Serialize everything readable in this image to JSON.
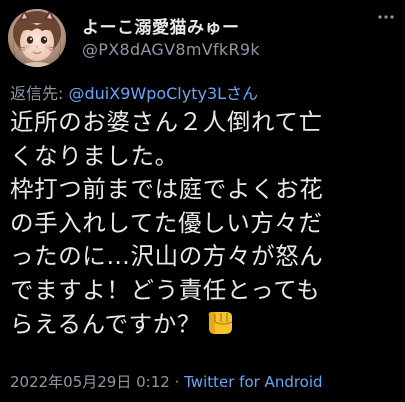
{
  "author": {
    "display_name": "よーこ溺愛猫みゅー",
    "handle": "@PX8dAGV8mVfkR9k"
  },
  "reply_to": {
    "prefix": "返信先: ",
    "handle": "@duiX9WpoClyty3Lさん"
  },
  "tweet": {
    "lines": [
      "近所のお婆さん２人倒れて亡",
      "くなりました。",
      "枠打つ前までは庭でよくお花",
      "の手入れしてた優しい方々だ",
      "ったのに…沢山の方々が怒ん",
      "でますよ！どう責任とっても",
      "らえるんですか？"
    ],
    "emoji": "oncoming-fist"
  },
  "meta": {
    "timestamp": "2022年05月29日 0:12",
    "separator": " · ",
    "source": "Twitter for Android"
  },
  "colors": {
    "background": "#000000",
    "text": "#e7e9ea",
    "secondary": "#8b98a5",
    "link": "#6aa6f8",
    "emoji": "#f4c430"
  },
  "icons": {
    "more": "more-icon",
    "avatar": "avatar"
  }
}
